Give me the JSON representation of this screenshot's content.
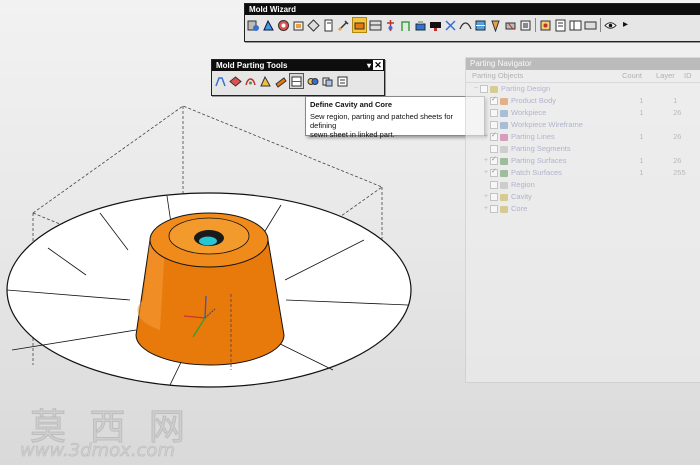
{
  "mold_wizard": {
    "title": "Mold Wizard"
  },
  "parting_tools": {
    "title": "Mold Parting Tools"
  },
  "tooltip": {
    "title": "Define Cavity and Core",
    "description_line1": "Sew region, parting and patched sheets for defining",
    "description_line2": "sewn sheet in linked part."
  },
  "navigator": {
    "title": "Parting Navigator",
    "columns": [
      "Parting Objects",
      "Count",
      "Layer",
      "ID"
    ],
    "rows": [
      {
        "name": "Parting Design",
        "count": "",
        "layer": "",
        "checked": false,
        "icon_color": "#c9b85a",
        "level": 0
      },
      {
        "name": "Product Body",
        "count": "1",
        "layer": "1",
        "checked": true,
        "icon_color": "#d98a4a",
        "level": 1
      },
      {
        "name": "Workpiece",
        "count": "1",
        "layer": "26",
        "checked": false,
        "icon_color": "#7aa0c8",
        "level": 1
      },
      {
        "name": "Workpiece Wireframe",
        "count": "",
        "layer": "",
        "checked": false,
        "icon_color": "#7aa0c8",
        "level": 1
      },
      {
        "name": "Parting Lines",
        "count": "1",
        "layer": "26",
        "checked": true,
        "icon_color": "#c86b9a",
        "level": 1
      },
      {
        "name": "Parting Segments",
        "count": "",
        "layer": "",
        "checked": false,
        "icon_color": "#bbbbbb",
        "level": 1
      },
      {
        "name": "Parting Surfaces",
        "count": "1",
        "layer": "26",
        "checked": true,
        "icon_color": "#6aa06a",
        "level": 1
      },
      {
        "name": "Patch Surfaces",
        "count": "1",
        "layer": "255",
        "checked": true,
        "icon_color": "#6aa06a",
        "level": 1
      },
      {
        "name": "Region",
        "count": "",
        "layer": "",
        "checked": false,
        "icon_color": "#bbbbbb",
        "level": 1
      },
      {
        "name": "Cavity",
        "count": "",
        "layer": "",
        "checked": false,
        "icon_color": "#c9b85a",
        "level": 1
      },
      {
        "name": "Core",
        "count": "",
        "layer": "",
        "checked": false,
        "icon_color": "#c9b85a",
        "level": 1
      }
    ]
  },
  "watermark": {
    "chars": "莫 西 网",
    "url": "www.3dmox.com"
  }
}
